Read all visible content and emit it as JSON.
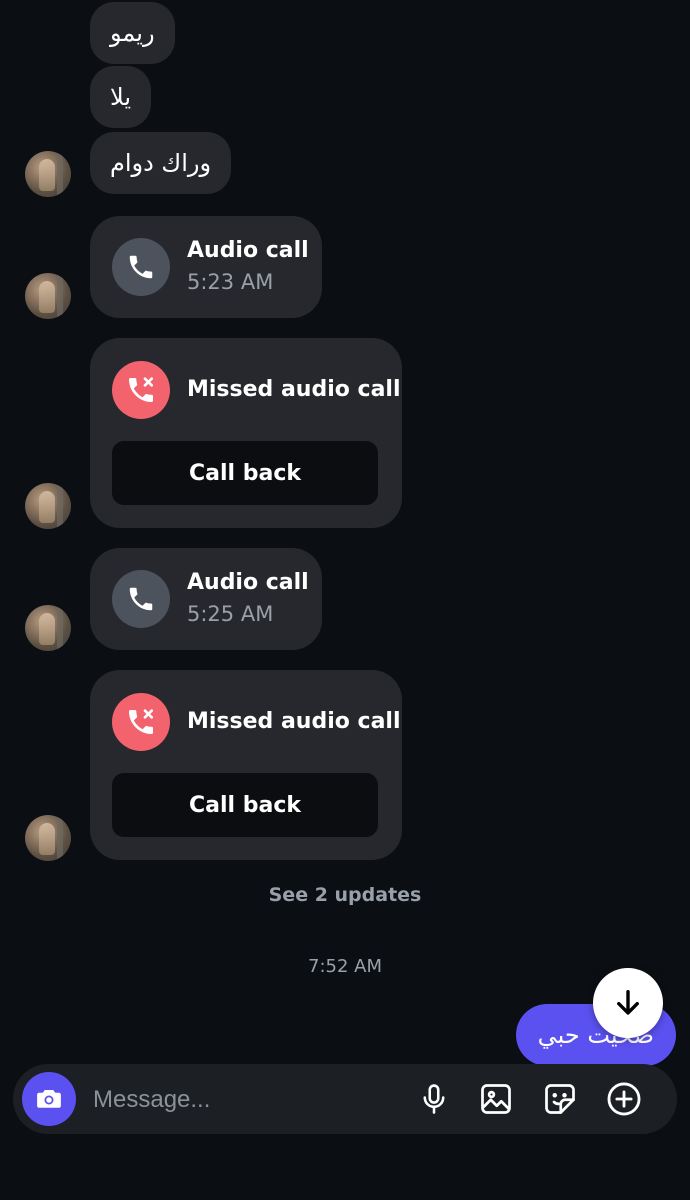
{
  "thread": {
    "text_messages": [
      "ريمو",
      "يلا",
      "وراك دوام"
    ],
    "calls": [
      {
        "title": "Audio call",
        "time": "5:23 AM"
      },
      {
        "title": "Missed audio call",
        "action": "Call back"
      },
      {
        "title": "Audio call",
        "time": "5:25 AM"
      },
      {
        "title": "Missed audio call",
        "action": "Call back"
      }
    ],
    "see_updates": "See 2 updates",
    "timestamp": "7:52 AM",
    "sent_message": "صحيت حبي"
  },
  "composer": {
    "placeholder": "Message...",
    "icons": [
      "camera-icon",
      "microphone-icon",
      "gallery-icon",
      "sticker-icon",
      "plus-icon"
    ]
  },
  "colors": {
    "background": "#0b0e13",
    "bubble": "#26282d",
    "accent": "#5b51f0",
    "missed": "#f2636e"
  }
}
